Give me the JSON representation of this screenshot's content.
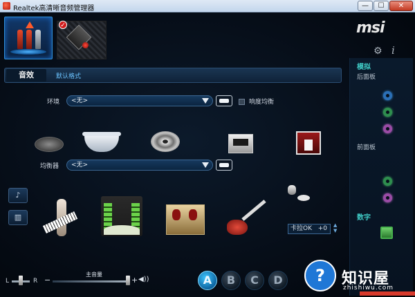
{
  "window": {
    "title": "Realtek高清晰音频管理器",
    "min_glyph": "—",
    "max_glyph": "☐",
    "close_glyph": "✕"
  },
  "brand": {
    "logo": "msi"
  },
  "icons": {
    "gear": "⚙",
    "info": "i"
  },
  "right_panel": {
    "analog_header": "模拟",
    "back_panel_label": "后面板",
    "front_panel_label": "前面板",
    "digital_header": "数字",
    "back_jacks": [
      "blue",
      "green",
      "pink"
    ],
    "front_jacks": [
      "green",
      "pink"
    ]
  },
  "tabs": {
    "active": "音效",
    "secondary": "默认格式"
  },
  "environment": {
    "label": "环境",
    "value": "<无>",
    "loudness_label": "响度均衡"
  },
  "equalizer": {
    "label": "均衡器",
    "value": "<无>"
  },
  "karaoke": {
    "label": "卡拉OK",
    "value": "+0"
  },
  "volume": {
    "label": "主音量",
    "left": "L",
    "right": "R",
    "minus": "−",
    "plus": "+",
    "speaker": "◀))",
    "level": 1.0
  },
  "presets": [
    "A",
    "B",
    "C",
    "D"
  ],
  "active_preset": "A",
  "watermark": {
    "symbol": "?",
    "text": "知识屋",
    "url": "zhishiwu.com"
  },
  "colors": {
    "accent": "#3ec6ff",
    "section_header": "#3fc9c4",
    "background": "#050b14"
  }
}
